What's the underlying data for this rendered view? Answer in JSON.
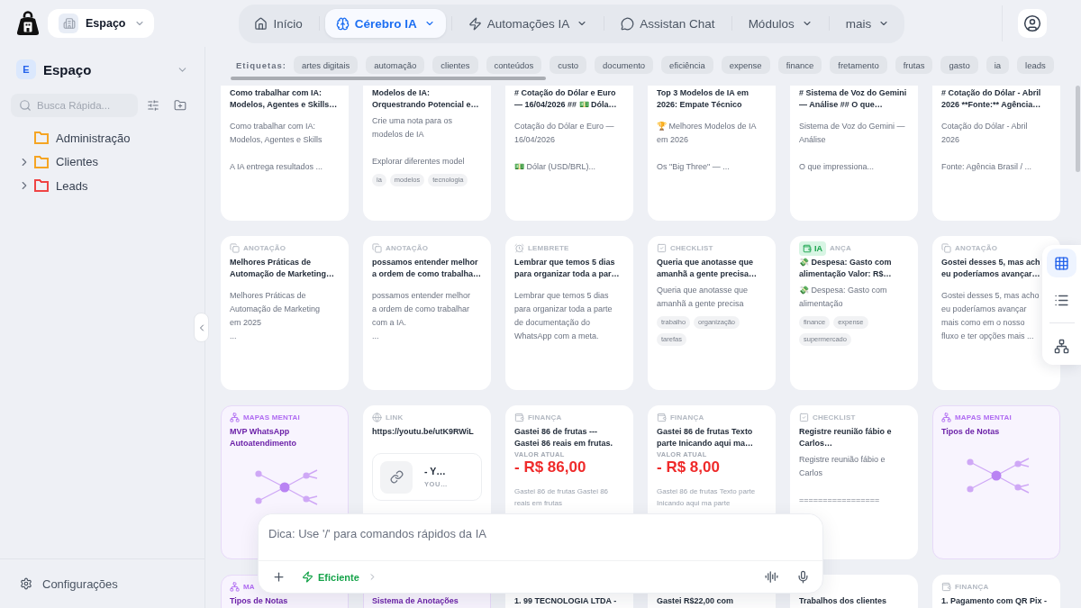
{
  "header": {
    "workspace": {
      "name": "Espaço"
    },
    "nav": [
      {
        "kind": "home",
        "label": "Início",
        "selected": false,
        "dropdown": false
      },
      {
        "kind": "brain",
        "label": "Cérebro IA",
        "selected": true,
        "dropdown": true
      },
      {
        "kind": "zap",
        "label": "Automações IA",
        "selected": false,
        "dropdown": true
      },
      {
        "kind": "chat",
        "label": "Assistan Chat",
        "selected": false,
        "dropdown": false
      },
      {
        "kind": "plain",
        "label": "Módulos",
        "selected": false,
        "dropdown": true
      },
      {
        "kind": "plain",
        "label": "mais",
        "selected": false,
        "dropdown": true
      }
    ]
  },
  "sidebar": {
    "space": {
      "initial": "E",
      "name": "Espaço"
    },
    "search": {
      "placeholder": "Busca Rápida..."
    },
    "folders": [
      {
        "label": "Administração",
        "color": "#f5a524",
        "expandable": false,
        "expanded": false
      },
      {
        "label": "Clientes",
        "color": "#f5a524",
        "expandable": true,
        "expanded": false
      },
      {
        "label": "Leads",
        "color": "#ef4444",
        "expandable": true,
        "expanded": false
      }
    ],
    "settings": "Configurações"
  },
  "tags": {
    "label": "Etiquetas:",
    "items": [
      "artes digitais",
      "automação",
      "clientes",
      "conteúdos",
      "custo",
      "documento",
      "eficiência",
      "expense",
      "finance",
      "fretamento",
      "frutas",
      "gasto",
      "ia",
      "leads"
    ]
  },
  "cards": [
    {
      "title": "Como trabalhar com IA:\nModelos, Agentes e Skills…",
      "body": "Como trabalhar com IA:\nModelos, Agentes e Skills\n\nA IA entrega resultados ..."
    },
    {
      "title": "Modelos de IA:\nOrquestrando Potencial e…",
      "body": "Crie uma nota para os\nmodelos de IA\n\nExplorar diferentes model",
      "tags": [
        "ia",
        "modelos",
        "tecnologia"
      ]
    },
    {
      "title": "# Cotação do Dólar e Euro\n— 16/04/2026 ## 💵 Dóla…",
      "body": "Cotação do Dólar e Euro —\n16/04/2026\n\n💵 Dólar (USD/BRL)..."
    },
    {
      "title": "Top 3 Modelos de IA em\n2026: Empate Técnico",
      "body": "🏆 Melhores Modelos de IA\nem 2026\n\nOs \"Big Three\" — ..."
    },
    {
      "title": "# Sistema de Voz do Gemini\n— Análise ## O que…",
      "body": "Sistema de Voz do Gemini —\nAnálise\n\nO que impressiona..."
    },
    {
      "title": "# Cotação do Dólar - Abril\n2026 **Fonte:** Agência…",
      "body": "Cotação do Dólar - Abril\n2026\n\nFonte: Agência Brasil / ..."
    },
    {
      "kind": "note",
      "label": "ANOTAÇÃO",
      "title": "Melhores Práticas de\nAutomação de Marketing…",
      "body": "Melhores Práticas de\nAutomação de Marketing\nem 2025\n..."
    },
    {
      "kind": "note",
      "label": "ANOTAÇÃO",
      "title": "possamos entender melhor\na ordem de como trabalha…",
      "body": "possamos entender melhor\na ordem de como trabalhar\ncom a IA.\n..."
    },
    {
      "kind": "reminder",
      "label": "LEMBRETE",
      "title": "Lembrar que temos 5 dias\npara organizar toda a par…",
      "body": "Lembrar que temos 5 dias\npara organizar toda a parte\nde documentação do\nWhatsApp com a meta."
    },
    {
      "kind": "checklist",
      "label": "CHECKLIST",
      "title": "Queria que anotasse que\namanhã a gente precisa…",
      "body": "Queria que anotasse que\namanhã a gente precisa",
      "tags": [
        "trabalho",
        "organização",
        "tarefas"
      ]
    },
    {
      "kind": "finance",
      "badge": "IA",
      "label": "ANÇA",
      "title": "💸 Despesa: Gasto com\nalimentação Valor: R$…",
      "body": "💸 Despesa: Gasto com\nalimentação",
      "tags": [
        "finance",
        "expense",
        "supermercado"
      ]
    },
    {
      "kind": "note",
      "label": "ANOTAÇÃO",
      "title": "Gostei desses 5, mas ach\neu poderíamos avançar…",
      "body": "Gostei desses 5, mas acho\neu poderíamos avançar\nmais como em o nosso\nfluxo e ter opções mais ..."
    },
    {
      "kind": "mindmap",
      "label": "MAPAS MENTAI",
      "title": "MVP WhatsApp\nAutoatendimento",
      "thumbnail": true
    },
    {
      "kind": "link",
      "label": "LINK",
      "title": "https://youtu.be/utK9RWiL",
      "preview": {
        "title": "- Y…",
        "source": "YOU…"
      }
    },
    {
      "kind": "finance",
      "label": "FINANÇA",
      "title": "Gastei 86 de frutas ---\nGastei 86 reais em frutas.",
      "amount_label": "VALOR ATUAL",
      "amount": "- R$ 86,00",
      "detail": "Gastei 86 de frutas Gastei 86\nreais em frutas"
    },
    {
      "kind": "finance",
      "label": "FINANÇA",
      "title": "Gastei 86 de frutas Texto\nparte Inicando aqui ma…",
      "amount_label": "VALOR ATUAL",
      "amount": "- R$ 8,00",
      "detail": "Gastei 86 de frutas Texto parte\nInicando aqui ma parte"
    },
    {
      "kind": "checklist",
      "label": "CHECKLIST",
      "title": "Registre reunião fábio e\nCarlos…",
      "body": "Registre reunião fábio e\nCarlos\n\n================="
    },
    {
      "kind": "mindmap",
      "label": "MAPAS MENTAI",
      "title": "Tipos de Notas",
      "thumbnail": true
    },
    {
      "kind": "mindmap",
      "label": "MA",
      "title": "Tipos de Notas"
    },
    {
      "kind": "mindmap",
      "title": "Sistema de Anotações"
    },
    {
      "title": "1. 99 TECNOLOGIA LTDA -"
    },
    {
      "title": "Gastei R$22,00 com"
    },
    {
      "title": "Trabalhos dos clientes"
    },
    {
      "kind": "finance",
      "label": "FINANÇA",
      "title": "1. Pagamento com QR Pix -"
    }
  ],
  "views": [
    {
      "kind": "grid",
      "selected": true
    },
    {
      "kind": "list",
      "selected": false
    },
    {
      "kind": "tree",
      "selected": false
    }
  ],
  "command_bar": {
    "placeholder": "Dica: Use '/' para comandos rápidos da IA",
    "mode": "Eficiente"
  }
}
